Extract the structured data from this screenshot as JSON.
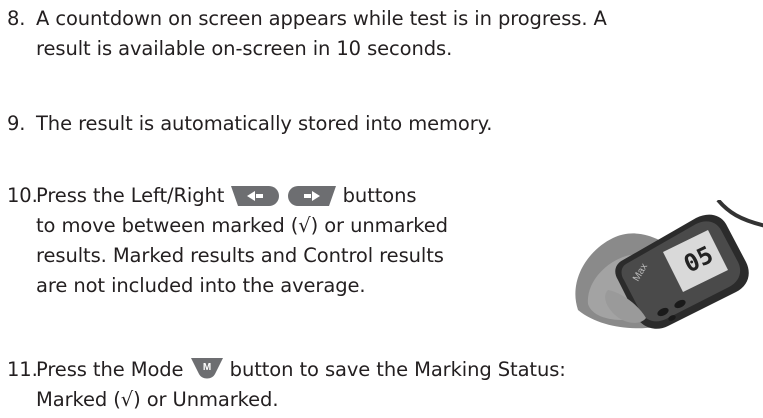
{
  "steps": [
    {
      "number": "8.",
      "lines": [
        "A countdown on screen appears while test is in progress. A",
        "result is available on-screen in 10 seconds."
      ]
    },
    {
      "number": "9.",
      "lines": [
        "The result is automatically stored into memory."
      ]
    },
    {
      "number": "10.",
      "line1_before": "Press the Left/Right",
      "line1_after": "buttons",
      "lines": [
        "to move between marked (√) or unmarked",
        "results. Marked results and Control results",
        "are not included into the average."
      ]
    },
    {
      "number": "11.",
      "line1_before": "Press the Mode",
      "line1_after": "button to save the Marking Status:",
      "lines": [
        "Marked (√) or Unmarked."
      ]
    }
  ],
  "icons": {
    "left_button": "left-arrow-button-icon",
    "right_button": "right-arrow-button-icon",
    "mode_button": "mode-m-button-icon",
    "mode_button_letter": "M",
    "button_color": "#6d6e71"
  },
  "device_photo": {
    "screen_reading": "05",
    "brand": "Max"
  }
}
